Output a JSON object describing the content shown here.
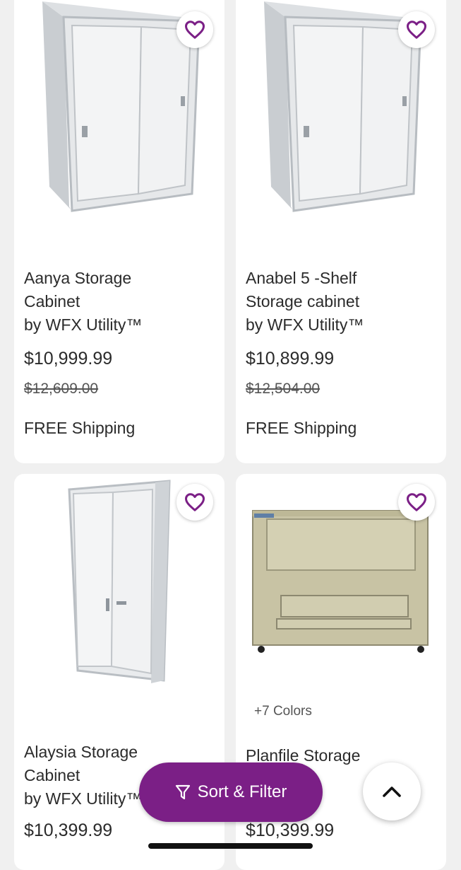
{
  "products": [
    {
      "title_lines": [
        "Aanya Storage",
        "Cabinet",
        "by WFX Utility™"
      ],
      "price": "$10,999.99",
      "was_price": "$12,609.00",
      "shipping": "FREE Shipping",
      "favorite_icon": "heart-outline-icon"
    },
    {
      "title_lines": [
        "Anabel 5 -Shelf",
        "Storage cabinet",
        "by WFX Utility™"
      ],
      "price": "$10,899.99",
      "was_price": "$12,504.00",
      "shipping": "FREE Shipping",
      "favorite_icon": "heart-outline-icon"
    },
    {
      "title_lines": [
        "Alaysia Storage",
        "Cabinet",
        "by WFX Utility™"
      ],
      "price": "$10,399.99",
      "favorite_icon": "heart-outline-icon"
    },
    {
      "colors_label": "+7 Colors",
      "title_lines": [
        "Planfile Storage",
        "",
        ""
      ],
      "price": "$10,399.99",
      "favorite_icon": "heart-outline-icon"
    }
  ],
  "sort_filter": {
    "label": "Sort & Filter",
    "icon": "filter-funnel-icon"
  },
  "back_to_top": {
    "icon": "chevron-up-icon"
  },
  "colors": {
    "accent": "#7b1f86",
    "background": "#f0f0f0",
    "card": "#ffffff"
  }
}
